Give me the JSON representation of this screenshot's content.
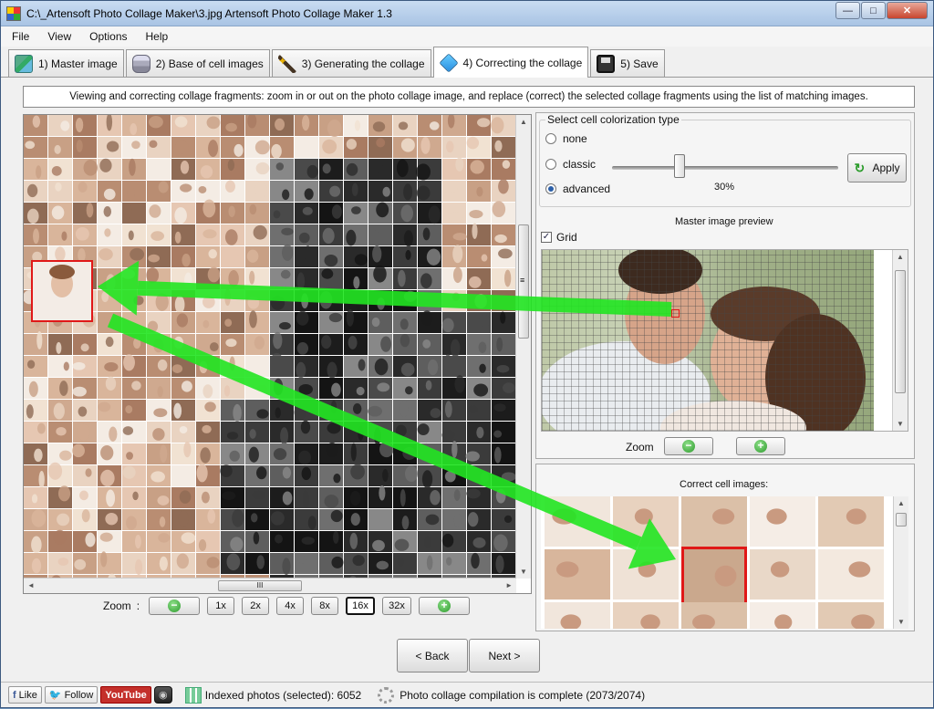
{
  "window": {
    "title": "C:\\_Artensoft Photo Collage Maker\\3.jpg Artensoft Photo Collage Maker 1.3",
    "minimize": "—",
    "maximize": "□",
    "close": "✕"
  },
  "menu": [
    "File",
    "View",
    "Options",
    "Help"
  ],
  "tabs": [
    {
      "label": "1) Master image",
      "icon": "master-image-icon"
    },
    {
      "label": "2) Base of cell images",
      "icon": "database-icon"
    },
    {
      "label": "3) Generating the collage",
      "icon": "magic-wand-icon"
    },
    {
      "label": "4) Correcting the collage",
      "icon": "cube-icon",
      "active": true
    },
    {
      "label": "5) Save",
      "icon": "floppy-disk-icon"
    }
  ],
  "description": "Viewing and correcting collage fragments: zoom in or out on the photo collage image, and replace (correct) the selected collage fragments using the list of matching images.",
  "collage_zoom": {
    "label": "Zoom",
    "colon": ":",
    "levels": [
      "1x",
      "2x",
      "4x",
      "8x",
      "16x",
      "32x"
    ],
    "selected": "16x",
    "minus": "−",
    "plus": "+"
  },
  "scroll_marks": {
    "up": "▲",
    "down": "▼",
    "left": "◄",
    "right": "►",
    "grip": "III",
    "grip_v": "≡"
  },
  "colorization": {
    "title": "Select cell colorization type",
    "options": [
      "none",
      "classic",
      "advanced"
    ],
    "selected": "advanced",
    "slider_value": "30%",
    "slider_level": 0.3,
    "apply_label": "Apply"
  },
  "preview": {
    "title": "Master image preview",
    "grid_label": "Grid",
    "grid_checked": true,
    "check_mark": "✓",
    "zoom_label": "Zoom"
  },
  "correct_cells": {
    "title": "Correct cell images:"
  },
  "nav": {
    "back": "< Back",
    "next": "Next >"
  },
  "status": {
    "like": "Like",
    "like_icon": "f",
    "follow": "Follow",
    "follow_icon": "🐦",
    "youtube": "YouTube",
    "instagram_icon": "◉",
    "indexed": "Indexed photos (selected): 6052",
    "compilation": "Photo collage compilation is complete (2073/2074)"
  },
  "colors": {
    "arrow": "#22e622",
    "selection": "#e01818",
    "accent": "#2b9a2b"
  }
}
